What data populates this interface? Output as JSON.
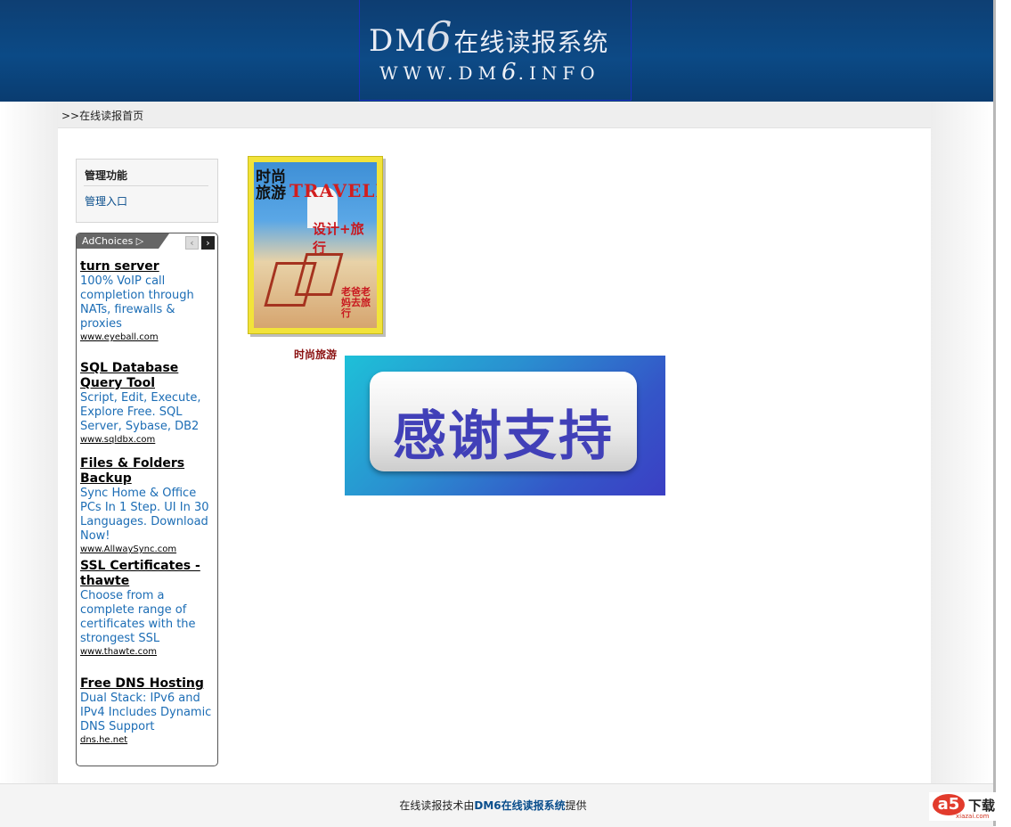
{
  "header": {
    "logo_dm": "DM",
    "logo_6": "6",
    "logo_cn": "在线读报系统",
    "logo_url_a": "WWW.DM",
    "logo_url_6": "6",
    "logo_url_b": ".INFO"
  },
  "breadcrumb": ">>在线读报首页",
  "admin": {
    "title": "管理功能",
    "link": "管理入口"
  },
  "ads": {
    "adchoices": "AdChoices ▷",
    "prev_icon": "‹",
    "next_icon": "›",
    "items": [
      {
        "title": "turn server",
        "desc": "100% VoIP call completion through NATs, firewalls & proxies",
        "url": "www.eyeball.com"
      },
      {
        "title": "SQL Database Query Tool",
        "desc": "Script, Edit, Execute, Explore Free. SQL Server, Sybase, DB2",
        "url": "www.sqldbx.com"
      },
      {
        "title": "Files & Folders Backup",
        "desc": "Sync Home & Office PCs In 1 Step. UI In 30 Languages. Download Now!",
        "url": "www.AllwaySync.com"
      },
      {
        "title": "SSL Certificates - thawte",
        "desc": "Choose from a complete range of certificates with the strongest SSL",
        "url": "www.thawte.com"
      },
      {
        "title": "Free DNS Hosting",
        "desc": "Dual Stack: IPv6 and IPv4 Includes Dynamic DNS Support",
        "url": "dns.he.net"
      }
    ]
  },
  "magazine": {
    "cover_title_cn": "时尚旅游",
    "cover_title_en": "TRAVELER",
    "cover_sub": "设计+旅行",
    "cover_badge": "老爸老妈去旅行",
    "caption": "时尚旅游"
  },
  "thanks": "感谢支持",
  "footer": {
    "prefix": "在线读报技术由",
    "link": "DM6在线读报系统",
    "suffix": "提供"
  },
  "watermark": {
    "logo": "a5",
    "text": "下载",
    "sub": "xiazai.com"
  }
}
